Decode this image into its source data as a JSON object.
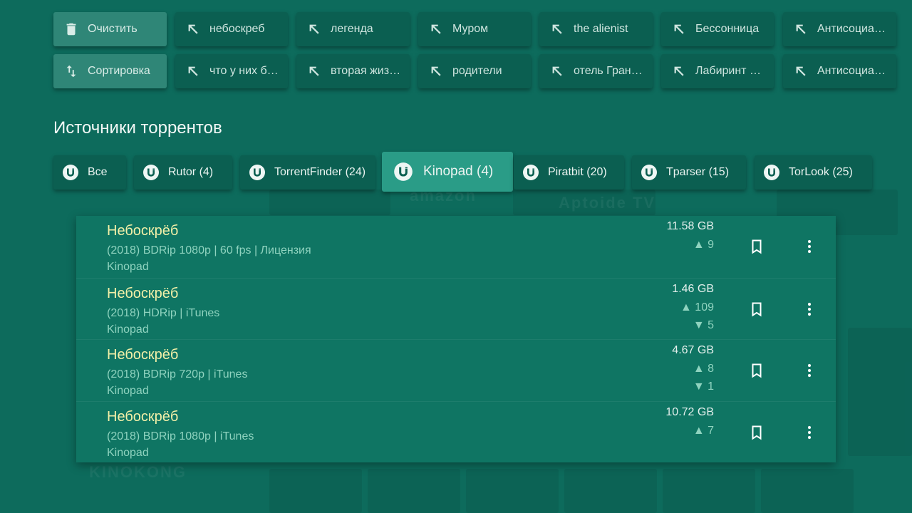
{
  "history": {
    "row1": [
      {
        "icon": "trash-icon",
        "label": "Очистить",
        "action": true
      },
      {
        "icon": "arrow-up-left-icon",
        "label": "небоскреб"
      },
      {
        "icon": "arrow-up-left-icon",
        "label": "легенда"
      },
      {
        "icon": "arrow-up-left-icon",
        "label": "Муром"
      },
      {
        "icon": "arrow-up-left-icon",
        "label": "the alienist"
      },
      {
        "icon": "arrow-up-left-icon",
        "label": "Бессонница"
      },
      {
        "icon": "arrow-up-left-icon",
        "label": "Антисоциалка"
      }
    ],
    "row2": [
      {
        "icon": "sort-icon",
        "label": "Сортировка",
        "action": true
      },
      {
        "icon": "arrow-up-left-icon",
        "label": "что у них бы…"
      },
      {
        "icon": "arrow-up-left-icon",
        "label": "вторая жизн…"
      },
      {
        "icon": "arrow-up-left-icon",
        "label": "родители"
      },
      {
        "icon": "arrow-up-left-icon",
        "label": "отель Гранд…"
      },
      {
        "icon": "arrow-up-left-icon",
        "label": "Лабиринт фа…"
      },
      {
        "icon": "arrow-up-left-icon",
        "label": "Антисоциалк…"
      }
    ]
  },
  "sources": {
    "title": "Источники торрентов",
    "items": [
      {
        "label": "Все"
      },
      {
        "label": "Rutor (4)"
      },
      {
        "label": "TorrentFinder (24)"
      },
      {
        "label": "Kinopad (4)",
        "selected": true
      },
      {
        "label": "Piratbit (20)"
      },
      {
        "label": "Tparser (15)"
      },
      {
        "label": "TorLook (25)"
      }
    ]
  },
  "results": [
    {
      "title": "Небоскрёб",
      "desc": "(2018) BDRip 1080p | 60 fps | Лицензия",
      "source": "Kinopad",
      "size": "11.58 GB",
      "seeds": "▲ 9",
      "leech": ""
    },
    {
      "title": "Небоскрёб",
      "desc": "(2018) HDRip | iTunes",
      "source": "Kinopad",
      "size": "1.46 GB",
      "seeds": "▲ 109",
      "leech": "▼ 5"
    },
    {
      "title": "Небоскрёб",
      "desc": "(2018) BDRip 720p | iTunes",
      "source": "Kinopad",
      "size": "4.67 GB",
      "seeds": "▲ 8",
      "leech": "▼ 1"
    },
    {
      "title": "Небоскрёб",
      "desc": "(2018) BDRip 1080p | iTunes",
      "source": "Kinopad",
      "size": "10.72 GB",
      "seeds": "▲ 7",
      "leech": ""
    }
  ],
  "background": {
    "texts": [
      "amazon",
      "Aptoide TV",
      "KINOKONG"
    ]
  },
  "colors": {
    "background": "#0d6b5c",
    "chip": "#0b5f51",
    "chip_action": "#2f8677",
    "selected": "#2a9c87",
    "title_yellow": "#f3f0a8",
    "secondary_text": "#8fd3bf"
  }
}
